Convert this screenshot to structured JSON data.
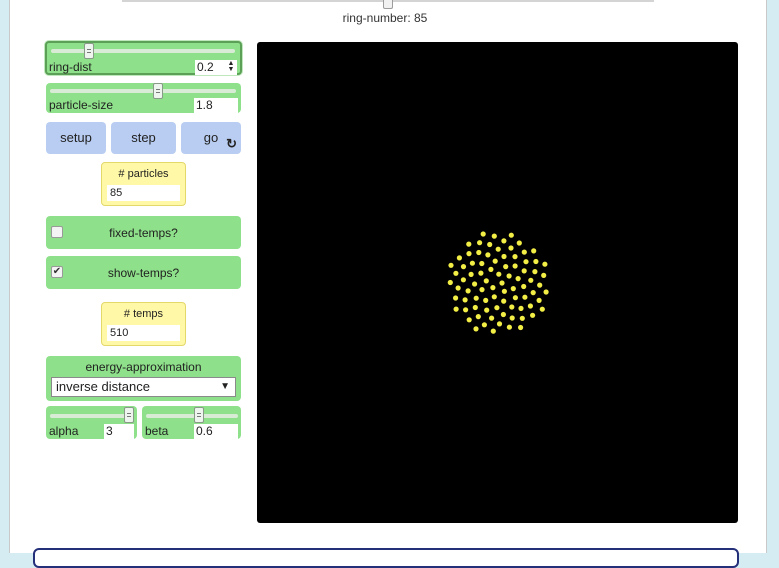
{
  "top_slider": {
    "caption": "ring-number: 85"
  },
  "ring_dist": {
    "label": "ring-dist",
    "value": "0.2",
    "level": 0.2
  },
  "particle_size": {
    "label": "particle-size",
    "value": "1.8",
    "level": 0.58
  },
  "buttons": {
    "setup": "setup",
    "step": "step",
    "go": "go",
    "go_icon": "forever-icon"
  },
  "particles_monitor": {
    "title": "# particles",
    "value": "85"
  },
  "fixed_temps": {
    "label": "fixed-temps?",
    "checked": false
  },
  "show_temps": {
    "label": "show-temps?",
    "checked": true,
    "mark": "✔"
  },
  "temps_monitor": {
    "title": "# temps",
    "value": "510"
  },
  "energy_approximation": {
    "label": "energy-approximation",
    "selected": "inverse distance"
  },
  "alpha": {
    "label": "alpha",
    "value": "3",
    "level": 0.95
  },
  "beta": {
    "label": "beta",
    "value": "0.6",
    "level": 0.6
  },
  "world": {
    "particle_color": "#f2ee45",
    "background": "#000000",
    "particle_count": 85
  }
}
